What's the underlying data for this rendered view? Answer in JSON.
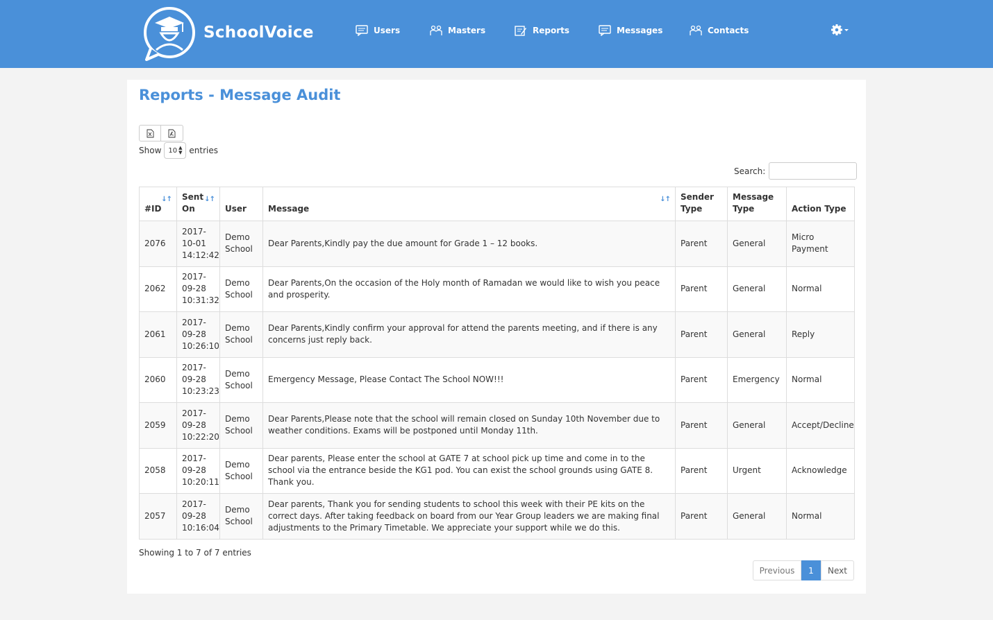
{
  "header": {
    "brand": "SchoolVoice",
    "nav": [
      {
        "label": "Users",
        "icon": "chat-icon"
      },
      {
        "label": "Masters",
        "icon": "people-icon"
      },
      {
        "label": "Reports",
        "icon": "report-icon"
      },
      {
        "label": "Messages",
        "icon": "chat-icon"
      },
      {
        "label": "Contacts",
        "icon": "people-icon"
      }
    ],
    "settings_icon": "gear-icon"
  },
  "page": {
    "title": "Reports - Message Audit",
    "export_buttons": [
      "excel-icon",
      "pdf-icon"
    ],
    "show_label": "Show",
    "entries_label": "entries",
    "page_length": "10",
    "search_label": "Search:",
    "search_value": ""
  },
  "table": {
    "columns": [
      "#ID",
      "Sent On",
      "User",
      "Message",
      "Sender Type",
      "Message Type",
      "Action Type"
    ],
    "rows": [
      {
        "id": "2076",
        "sent_on": "2017-10-01 14:12:42",
        "user": "Demo School",
        "message": "Dear Parents,Kindly pay the due amount for Grade 1 – 12 books.",
        "sender_type": "Parent",
        "message_type": "General",
        "action_type": "Micro Payment"
      },
      {
        "id": "2062",
        "sent_on": "2017-09-28 10:31:32",
        "user": "Demo School",
        "message": "Dear Parents,On the occasion of the Holy month of Ramadan we would like to wish you peace and prosperity.",
        "sender_type": "Parent",
        "message_type": "General",
        "action_type": "Normal"
      },
      {
        "id": "2061",
        "sent_on": "2017-09-28 10:26:10",
        "user": "Demo School",
        "message": "Dear Parents,Kindly confirm your approval for attend the parents meeting, and if there is any concerns just reply back.",
        "sender_type": "Parent",
        "message_type": "General",
        "action_type": "Reply"
      },
      {
        "id": "2060",
        "sent_on": "2017-09-28 10:23:23",
        "user": "Demo School",
        "message": "Emergency Message, Please Contact The School NOW!!!",
        "sender_type": "Parent",
        "message_type": "Emergency",
        "action_type": "Normal"
      },
      {
        "id": "2059",
        "sent_on": "2017-09-28 10:22:20",
        "user": "Demo School",
        "message": "Dear Parents,Please note that the school will remain closed on Sunday 10th November due to weather conditions. Exams will be postponed until Monday 11th.",
        "sender_type": "Parent",
        "message_type": "General",
        "action_type": "Accept/Decline"
      },
      {
        "id": "2058",
        "sent_on": "2017-09-28 10:20:11",
        "user": "Demo School",
        "message": "Dear parents, Please enter the school at GATE 7 at school pick up time and come in to the school via the entrance beside the KG1 pod. You can exist the school grounds using GATE 8. Thank you.",
        "sender_type": "Parent",
        "message_type": "Urgent",
        "action_type": "Acknowledge"
      },
      {
        "id": "2057",
        "sent_on": "2017-09-28 10:16:04",
        "user": "Demo School",
        "message": "Dear parents, Thank you for sending students to school this week with their PE kits on the correct days. After taking feedback on board from our Year Group leaders we are making final adjustments to the Primary Timetable. We appreciate your support while we do this.",
        "sender_type": "Parent",
        "message_type": "General",
        "action_type": "Normal"
      }
    ]
  },
  "footer": {
    "info": "Showing 1 to 7 of 7 entries",
    "previous": "Previous",
    "current_page": "1",
    "next": "Next"
  },
  "colors": {
    "brand_blue": "#4a90d9",
    "page_bg": "#f3f3f3"
  }
}
